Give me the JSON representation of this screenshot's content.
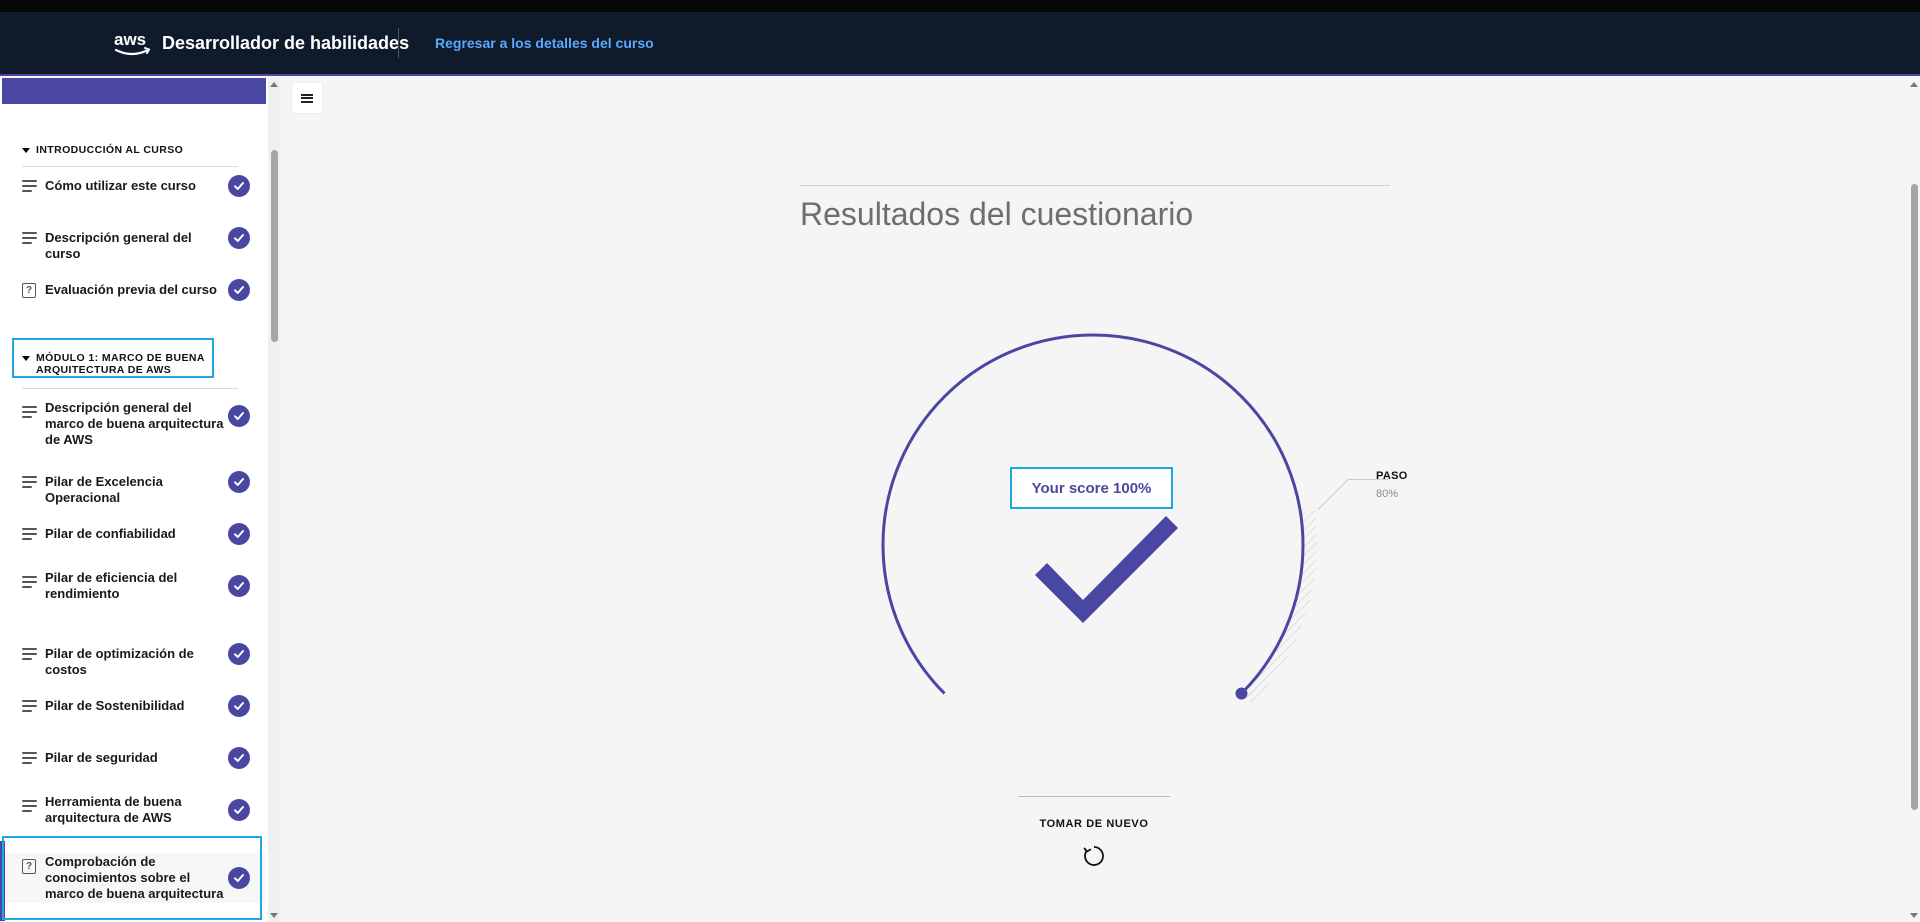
{
  "header": {
    "brand": "Desarrollador de habilidades",
    "back_link": "Regresar a los detalles del curso"
  },
  "sidebar": {
    "sections": [
      {
        "title": "INTRODUCCIÓN AL CURSO",
        "items": [
          {
            "label": "Cómo utilizar este curso",
            "type": "lesson",
            "completed": true
          },
          {
            "label": "Descripción general del curso",
            "type": "lesson",
            "completed": true
          },
          {
            "label": "Evaluación previa del curso",
            "type": "quiz",
            "completed": true
          }
        ]
      },
      {
        "title": "MÓDULO 1: MARCO DE BUENA ARQUITECTURA DE AWS",
        "items": [
          {
            "label": "Descripción general del marco de buena arquitectura de AWS",
            "type": "lesson",
            "completed": true
          },
          {
            "label": "Pilar de Excelencia Operacional",
            "type": "lesson",
            "completed": true
          },
          {
            "label": "Pilar de confiabilidad",
            "type": "lesson",
            "completed": true
          },
          {
            "label": "Pilar de eficiencia del rendimiento",
            "type": "lesson",
            "completed": true
          },
          {
            "label": "Pilar de optimización de costos",
            "type": "lesson",
            "completed": true
          },
          {
            "label": "Pilar de Sostenibilidad",
            "type": "lesson",
            "completed": true
          },
          {
            "label": "Pilar de seguridad",
            "type": "lesson",
            "completed": true
          },
          {
            "label": "Herramienta de buena arquitectura de AWS",
            "type": "lesson",
            "completed": true
          },
          {
            "label": "Comprobación de conocimientos sobre el marco de buena arquitectura",
            "type": "quiz",
            "completed": true,
            "active": true
          }
        ]
      }
    ]
  },
  "main": {
    "title": "Resultados del cuestionario",
    "score_text": "Your score 100%",
    "score_value": 100,
    "pass_label": "PASO",
    "pass_value": "80%",
    "pass_threshold": 80,
    "retake_label": "TOMAR DE NUEVO"
  },
  "colors": {
    "accent": "#4a47a3",
    "header_bg": "#0f1b2a",
    "link": "#5aa9ff",
    "highlight": "#1ea7e1"
  }
}
